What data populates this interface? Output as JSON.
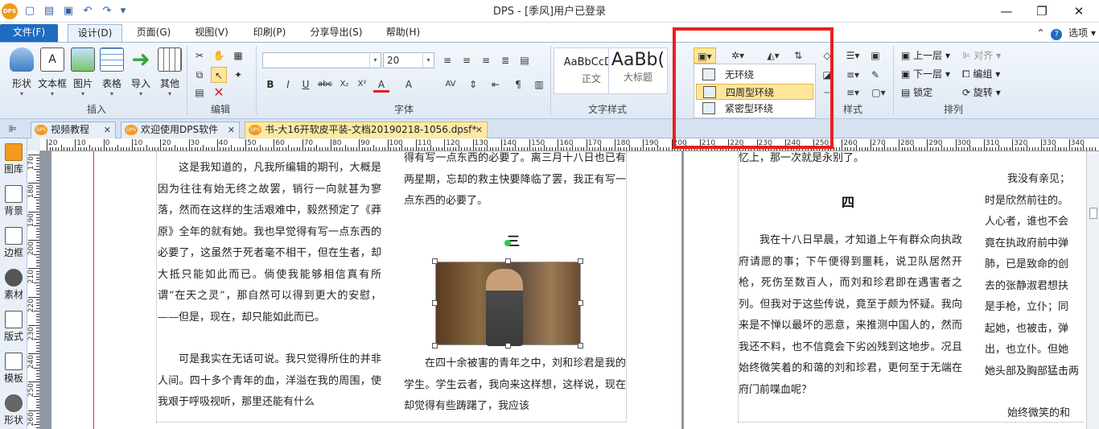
{
  "app": {
    "logo": "DPS",
    "title": "DPS - [季风]用户已登录"
  },
  "window_controls": {
    "minimize": "—",
    "restore": "❐",
    "close": "✕"
  },
  "menu": {
    "tabs": [
      "文件(F)",
      "设计(D)",
      "页面(G)",
      "视图(V)",
      "印刷(P)",
      "分享导出(S)",
      "帮助(H)"
    ],
    "active": "设计(D)",
    "options_label": "选项"
  },
  "ribbon": {
    "insert": {
      "buttons": [
        "形状",
        "文本框",
        "图片",
        "表格",
        "导入",
        "其他"
      ],
      "group_label": "插入"
    },
    "edit": {
      "group_label": "编辑"
    },
    "font": {
      "font_name": "",
      "font_size": "20",
      "format_buttons": [
        "B",
        "I",
        "U",
        "abc",
        "X₂",
        "X²",
        "A",
        "A"
      ],
      "group_label": "字体"
    },
    "text_style": {
      "styles": [
        {
          "preview": "AaBbCcDd",
          "name": "正文"
        },
        {
          "preview": "AaBb(",
          "name": "大标题"
        }
      ],
      "group_label": "文字样式"
    },
    "style": {
      "group_label": "样式"
    },
    "arrange": {
      "items": [
        "上一层",
        "下一层",
        "锁定",
        "对齐",
        "编组",
        "旋转"
      ],
      "group_label": "排列"
    }
  },
  "wrap_menu": {
    "items": [
      "无环绕",
      "四周型环绕",
      "紧密型环绕"
    ],
    "selected": "四周型环绕"
  },
  "doc_tabs": [
    {
      "label": "视频教程",
      "active": false
    },
    {
      "label": "欢迎使用DPS软件",
      "active": false
    },
    {
      "label": "书-大16开软皮平装-文档20190218-1056.dpsf*",
      "active": true
    }
  ],
  "left_panel": [
    "图库",
    "背景",
    "边框",
    "素材",
    "版式",
    "模板",
    "形状"
  ],
  "ruler": {
    "h_labels": [
      "20",
      "10",
      "0",
      "10",
      "20",
      "30",
      "40",
      "50",
      "60",
      "70",
      "80",
      "90",
      "100",
      "110",
      "120",
      "130",
      "140",
      "150",
      "160",
      "170",
      "180",
      "190",
      "200",
      "210",
      "220",
      "230",
      "240",
      "250",
      "260",
      "270",
      "280",
      "290",
      "300",
      "310",
      "320",
      "330",
      "340"
    ],
    "v_labels": [
      "170",
      "180",
      "190",
      "200",
      "210",
      "220",
      "230",
      "240",
      "250",
      "260"
    ]
  },
  "document": {
    "col1": {
      "p1": "这是我知道的，凡我所编辑的期刊，大概是因为往往有始无终之故罢，销行一向就甚为寥落，然而在这样的生活艰难中，毅然预定了《莽原》全年的就有她。我也早觉得有写一点东西的必要了，这虽然于死者毫不相干，但在生者，却大抵只能如此而已。倘使我能够相信真有所谓“在天之灵”，那自然可以得到更大的安慰，——但是，现在，却只能如此而已。",
      "p2": "可是我实在无话可说。我只觉得所住的并非人间。四十多个青年的血，洋溢在我的周围，使我艰于呼吸视听，那里还能有什么"
    },
    "col2": {
      "p1": "得有写一点东西的必要了。离三月十八日也已有两星期，忘却的救主快要降临了罢，我正有写一点东西的必要了。",
      "heading": "三",
      "p2": "在四十余被害的青年之中，刘和珍君是我的学生。学生云者，我向来这样想，这样说，现在却觉得有些踌躇了，我应该"
    },
    "col3": {
      "p1": "忆上，那一次就是永别了。",
      "heading": "四",
      "p2": "我在十八日早晨，才知道上午有群众向执政府请愿的事；下午便得到噩耗，说卫队居然开枪，死伤至数百人，而刘和珍君即在遇害者之列。但我对于这些传说，竟至于颇为怀疑。我向来是不惮以最坏的恶意，来推测中国人的，然而我还不料，也不信竟会下劣凶残到这地步。况且始终微笑着的和蔼的刘和珍君，更何至于无端在府门前喋血呢？"
    },
    "col4": {
      "lines": [
        "我没有亲见；",
        "时是欣然前往的。",
        "人心者，谁也不会",
        "竟在执政府前中弹",
        "肺，已是致命的创",
        "去的张静淑君想扶",
        "是手枪，立仆；同",
        "起她，也被击，弹",
        "出，也立仆。但她",
        "她头部及胸部猛击两",
        "",
        "始终微笑的和"
      ]
    }
  },
  "colors": {
    "accent": "#1f6bc1",
    "highlight": "#e82020",
    "tab_active": "#fce9a6",
    "menu_selected": "#fde69b"
  }
}
